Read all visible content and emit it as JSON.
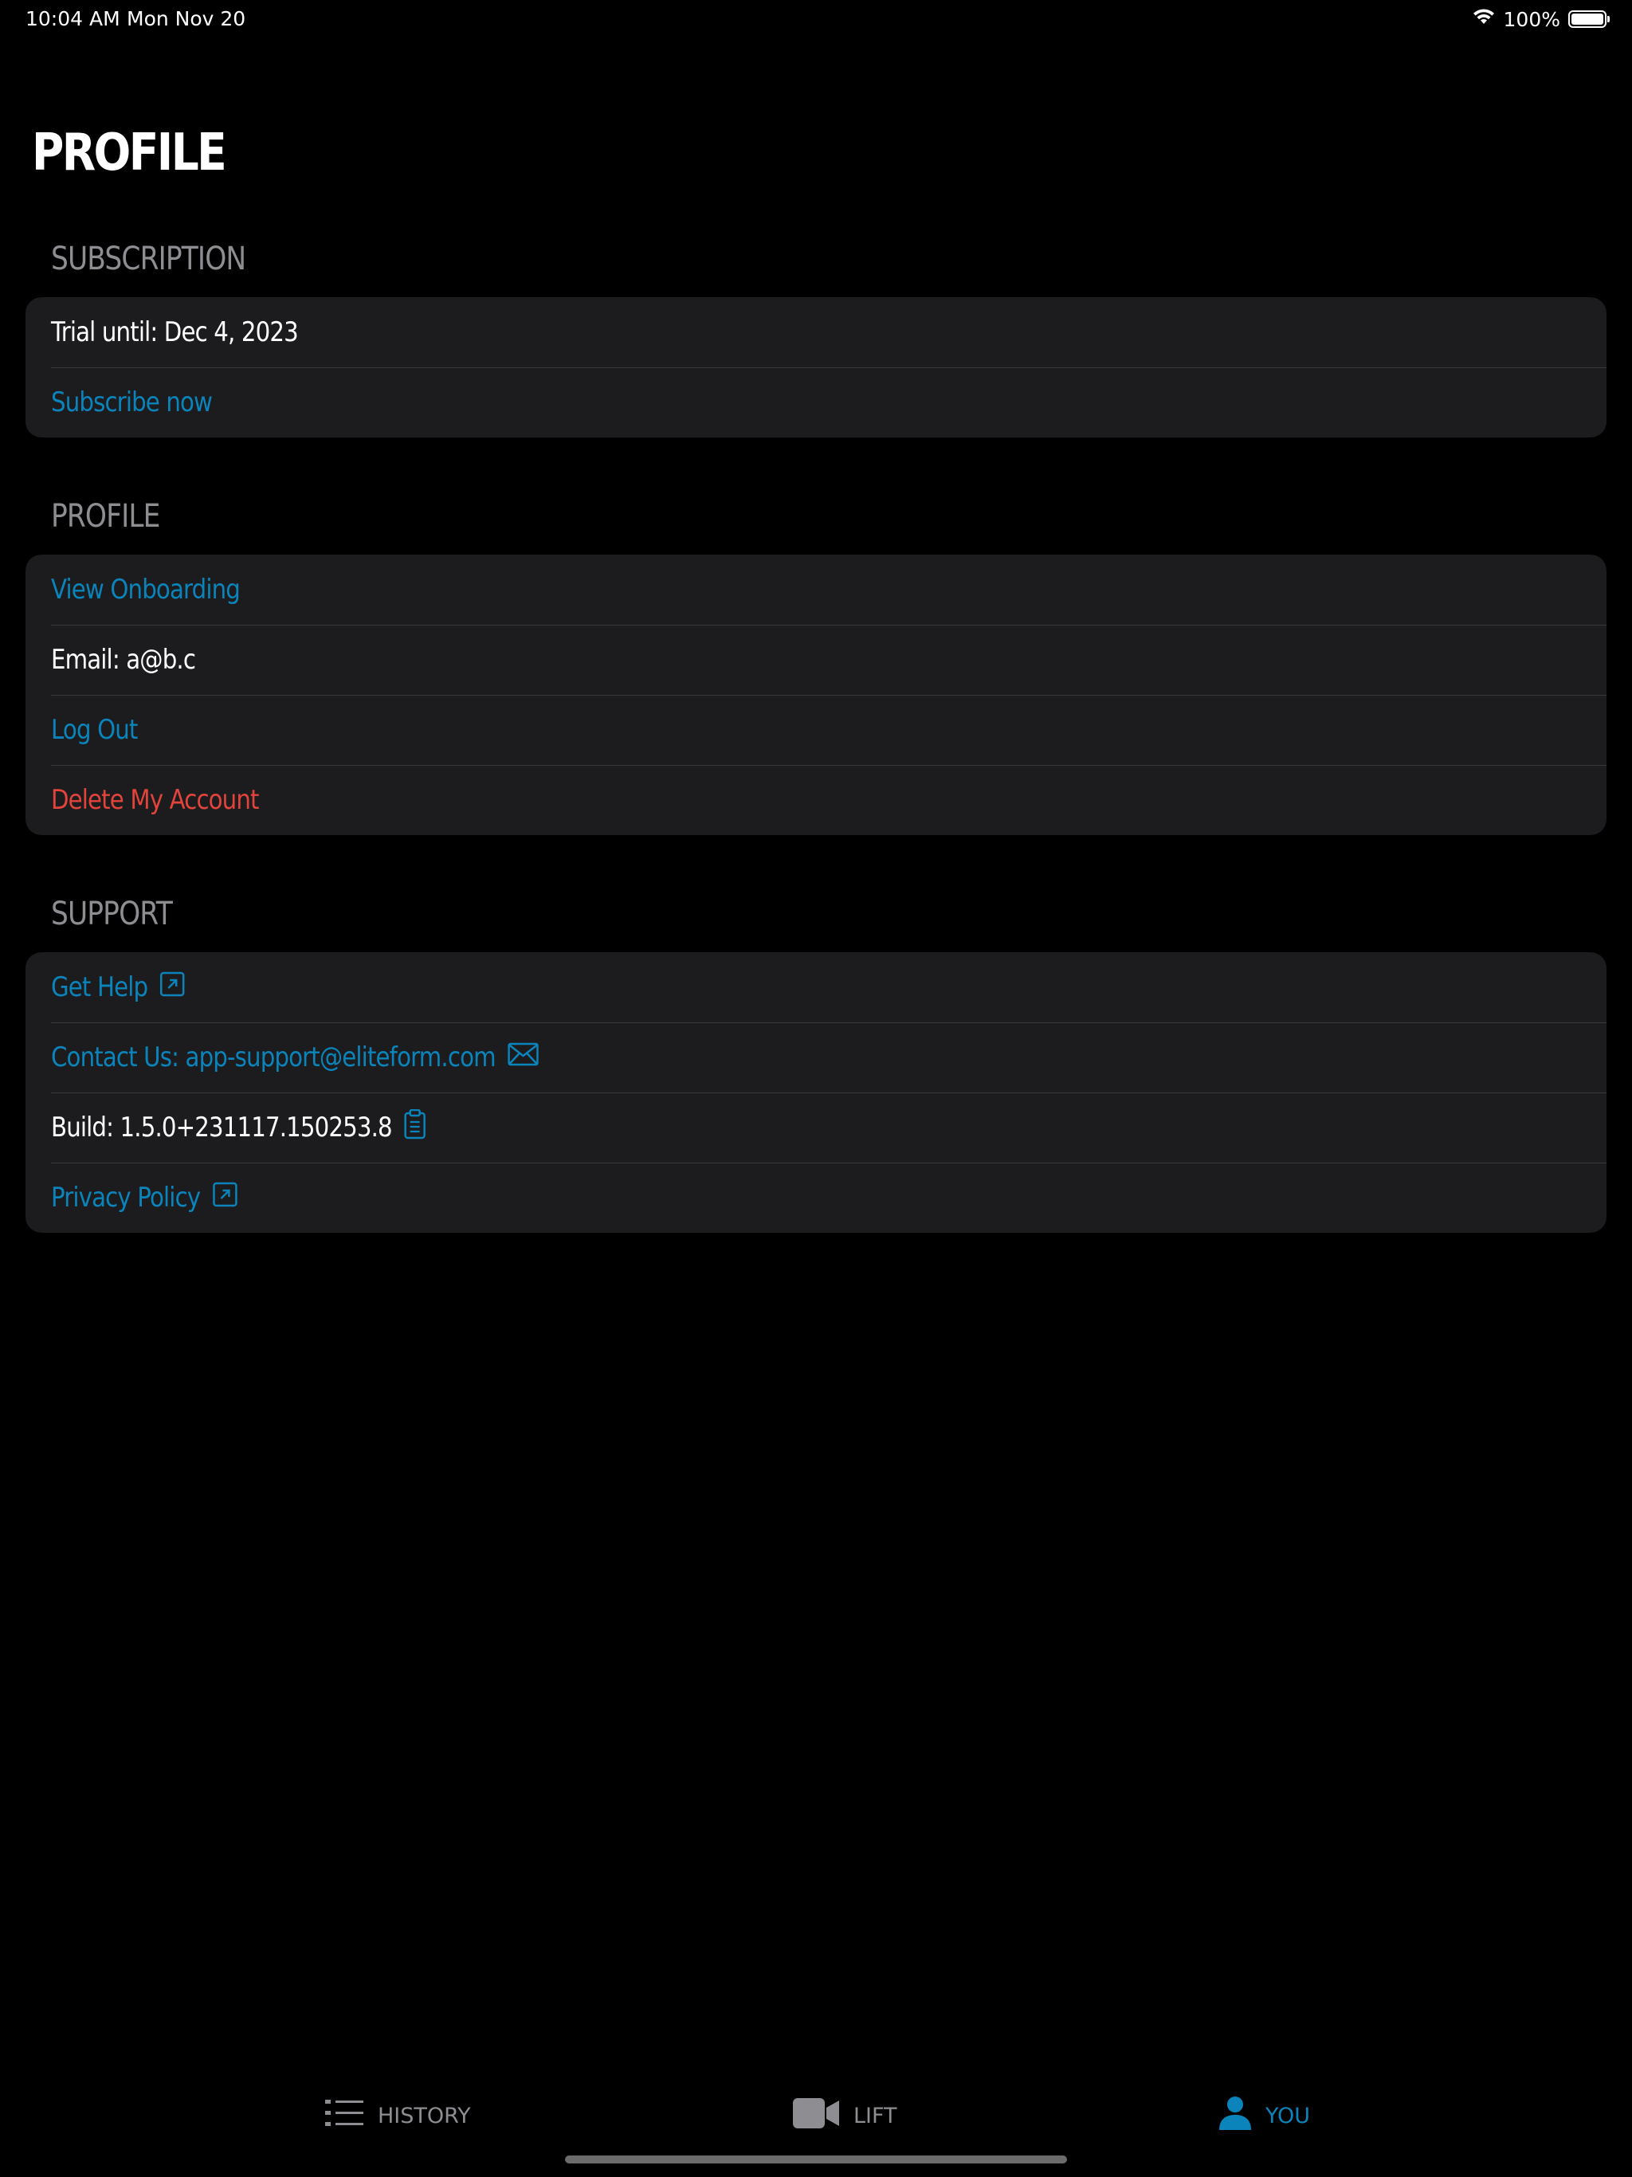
{
  "status_bar": {
    "time": "10:04 AM",
    "date": "Mon Nov 20",
    "battery": "100%",
    "battery_level": 1.0
  },
  "page": {
    "title": "PROFILE"
  },
  "subscription": {
    "header": "SUBSCRIPTION",
    "trial": "Trial until: Dec 4, 2023",
    "subscribe": "Subscribe now"
  },
  "profile": {
    "header": "PROFILE",
    "view_onboarding": "View Onboarding",
    "email": "Email: a@b.c",
    "log_out": "Log Out",
    "delete_account": "Delete My Account"
  },
  "support": {
    "header": "SUPPORT",
    "get_help": "Get Help",
    "contact": "Contact Us: app-support@eliteform.com",
    "build": "Build: 1.5.0+231117.150253.8",
    "privacy": "Privacy Policy"
  },
  "tab_bar": {
    "tabs": [
      {
        "label": "HISTORY",
        "icon": "list-icon",
        "active": false
      },
      {
        "label": "LIFT",
        "icon": "video-camera-icon",
        "active": false
      },
      {
        "label": "YOU",
        "icon": "person-icon",
        "active": true
      }
    ]
  },
  "colors": {
    "background": "#000000",
    "card": "#1c1c1e",
    "link": "#0a84ba",
    "danger": "#e0443b",
    "secondary_text": "#8d8d92"
  }
}
